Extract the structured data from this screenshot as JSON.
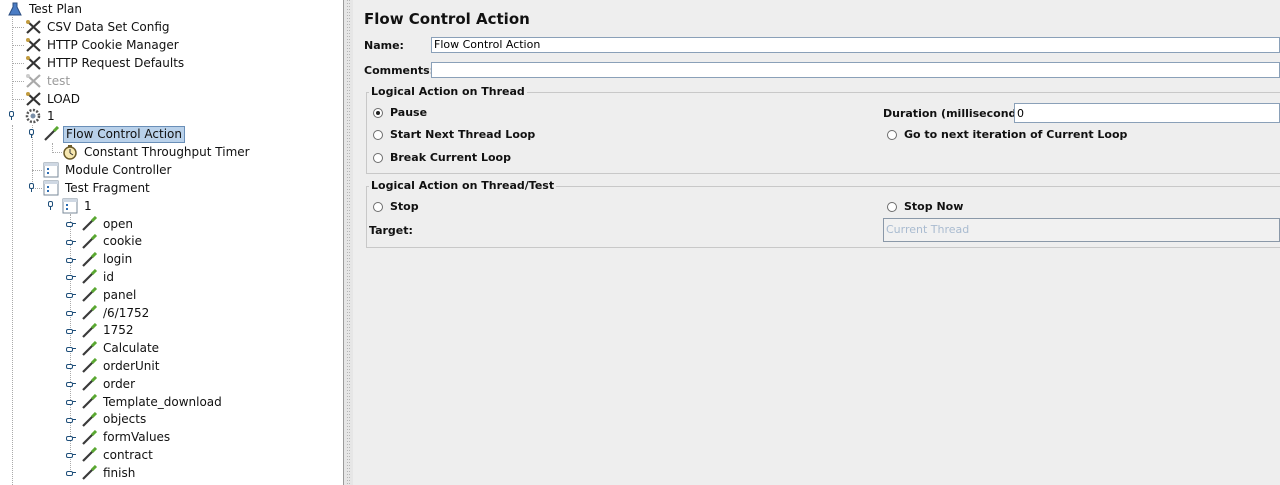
{
  "tree": {
    "items": [
      {
        "label": "Test Plan",
        "icon": "flask-icon"
      },
      {
        "label": "CSV Data Set Config",
        "icon": "wrench-scissors-icon"
      },
      {
        "label": "HTTP Cookie Manager",
        "icon": "wrench-scissors-icon"
      },
      {
        "label": "HTTP Request Defaults",
        "icon": "wrench-scissors-icon"
      },
      {
        "label": "test",
        "icon": "wrench-scissors-icon"
      },
      {
        "label": "LOAD",
        "icon": "wrench-scissors-icon"
      },
      {
        "label": "1",
        "icon": "gear-icon"
      },
      {
        "label": "Flow Control Action",
        "icon": "pipette-icon"
      },
      {
        "label": "Constant Throughput Timer",
        "icon": "stopwatch-icon"
      },
      {
        "label": "Module Controller",
        "icon": "controller-icon"
      },
      {
        "label": "Test Fragment",
        "icon": "controller-icon"
      },
      {
        "label": "1",
        "icon": "controller-icon"
      },
      {
        "label": "open",
        "icon": "pipette-icon"
      },
      {
        "label": "cookie",
        "icon": "pipette-icon"
      },
      {
        "label": "login",
        "icon": "pipette-icon"
      },
      {
        "label": "id",
        "icon": "pipette-icon"
      },
      {
        "label": "panel",
        "icon": "pipette-icon"
      },
      {
        "label": "/6/1752",
        "icon": "pipette-icon"
      },
      {
        "label": "1752",
        "icon": "pipette-icon"
      },
      {
        "label": "Calculate",
        "icon": "pipette-icon"
      },
      {
        "label": "orderUnit",
        "icon": "pipette-icon"
      },
      {
        "label": "order",
        "icon": "pipette-icon"
      },
      {
        "label": "Template_download",
        "icon": "pipette-icon"
      },
      {
        "label": "objects",
        "icon": "pipette-icon"
      },
      {
        "label": "formValues",
        "icon": "pipette-icon"
      },
      {
        "label": "contract",
        "icon": "pipette-icon"
      },
      {
        "label": "finish",
        "icon": "pipette-icon"
      }
    ]
  },
  "panel": {
    "title": "Flow Control Action",
    "name_label": "Name:",
    "name_value": "Flow Control Action",
    "comments_label": "Comments:",
    "comments_value": "",
    "thread_group": {
      "title": "Logical Action on Thread",
      "pause": "Pause",
      "start_next": "Start Next Thread Loop",
      "break_loop": "Break Current Loop",
      "duration_label": "Duration (milliseconds):",
      "duration_value": "0",
      "go_next": "Go to next iteration of Current Loop",
      "selected": "Pause"
    },
    "test_group": {
      "title": "Logical Action on Thread/Test",
      "stop": "Stop",
      "stop_now": "Stop Now",
      "target_label": "Target:",
      "target_value": "Current Thread"
    }
  },
  "colors": {
    "selection_bg": "#b9d1ea",
    "disabled_text": "#9a9a9a",
    "target_text": "#a9bbd0"
  }
}
